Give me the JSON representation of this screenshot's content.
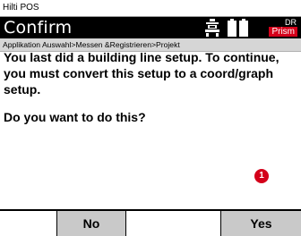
{
  "app": {
    "title": "Hilti POS"
  },
  "header": {
    "title": "Confirm",
    "icons": [
      "tribrach-icon",
      "battery-icon"
    ],
    "mode_top": "DR",
    "mode_bottom": "Prism"
  },
  "breadcrumb": "Applikation Auswahl>Messen &Registrieren>Projekt",
  "dialog": {
    "message": "You last did a building line setup.  To continue, you must convert this setup to a coord/graph setup.",
    "question": "Do you want to do this?",
    "marker": "1"
  },
  "softkeys": {
    "no": "No",
    "yes": "Yes"
  },
  "colors": {
    "header_bg": "#000000",
    "accent_red": "#d4001a",
    "softkey_bg": "#c9c9c9",
    "breadcrumb_bg": "#d6d6d6"
  }
}
